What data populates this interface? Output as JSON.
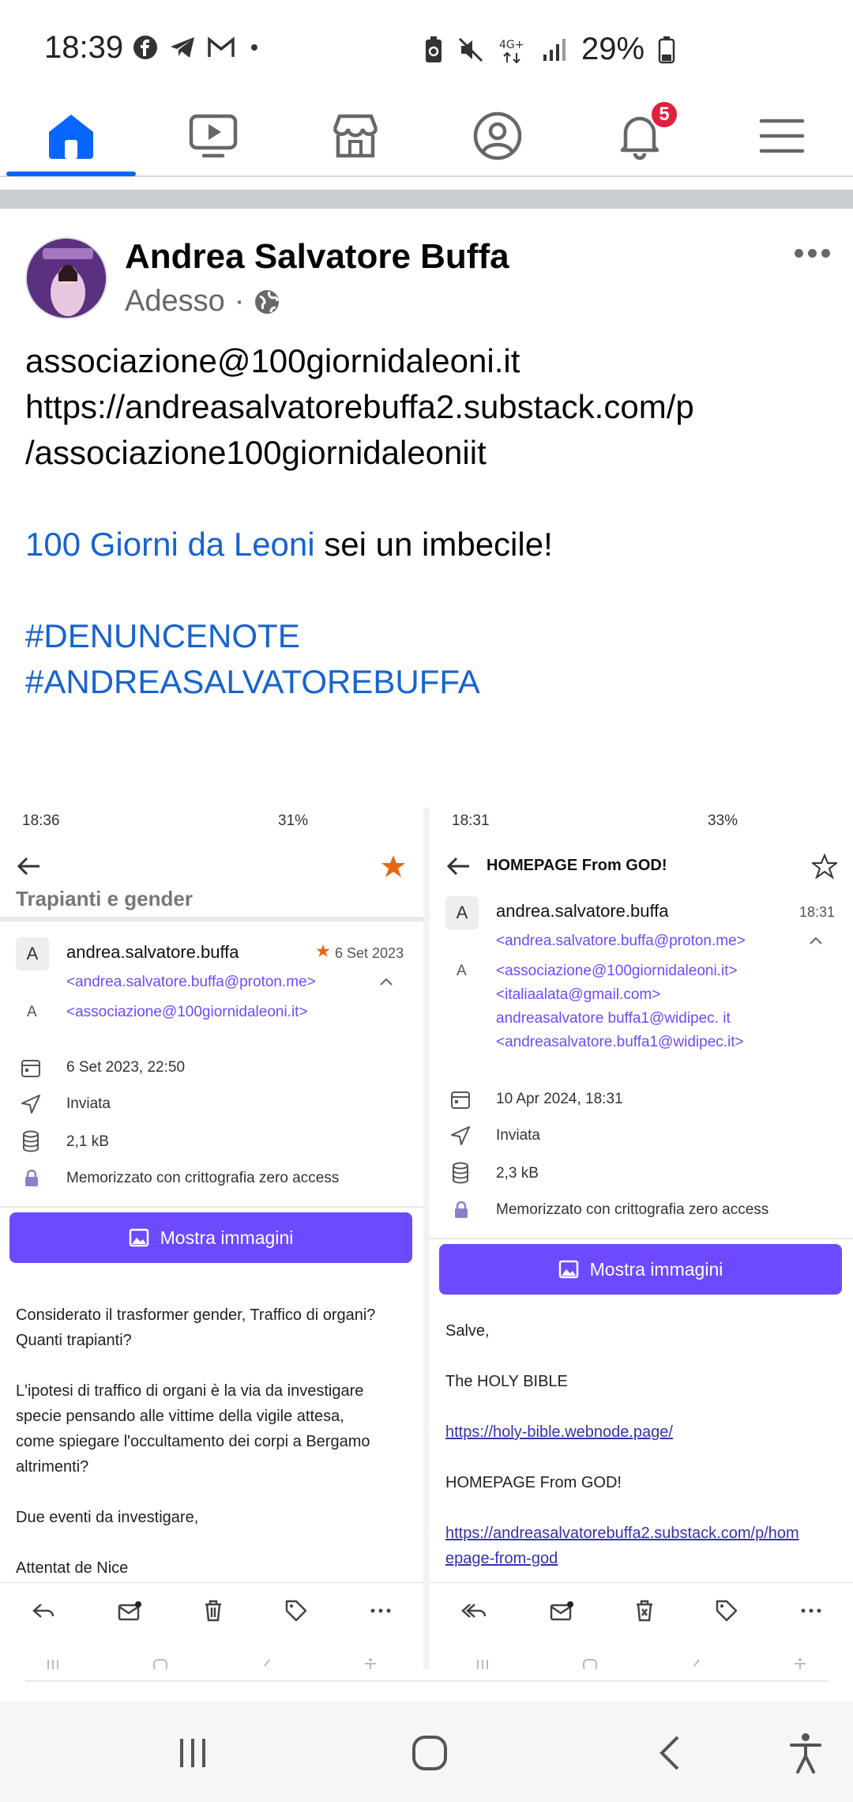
{
  "status_bar": {
    "time": "18:39",
    "battery": "29%",
    "left_icons": [
      "facebook-icon",
      "telegram-icon",
      "gmail-icon",
      "dot-icon"
    ],
    "right_icons": [
      "battery-saver-icon",
      "mute-icon",
      "network-4g-icon",
      "signal-icon"
    ]
  },
  "fb_nav": {
    "items": [
      "home",
      "video",
      "marketplace",
      "profile",
      "notifications",
      "menu"
    ],
    "notifications_badge": "5",
    "accent": "#0866ff"
  },
  "post": {
    "author": "Andrea Salvatore Buffa",
    "time": "Adesso",
    "separator": "·",
    "body_lines": [
      {
        "text": "associazione@100giornidaleoni.it"
      },
      {
        "text": "https://andreasalvatorebuffa2.substack.com/p"
      },
      {
        "text": "/associazione100giornidaleoniit"
      },
      {
        "text": ""
      },
      {
        "link": "100 Giorni da Leoni",
        "text": " sei un imbecile!"
      },
      {
        "text": ""
      },
      {
        "link": "#DENUNCENOTE"
      },
      {
        "link": "#ANDREASALVATOREBUFFA"
      },
      {
        "text": ""
      },
      {
        "text": ""
      },
      {
        "text": "."
      }
    ]
  },
  "left_email": {
    "status_time": "18:36",
    "status_battery": "31%",
    "subject": "Trapianti e gender",
    "sender_initial": "A",
    "sender": "andrea.salvatore.buffa",
    "date_short": "6 Set 2023",
    "sender_email": "<andrea.salvatore.buffa@proton.me>",
    "to_initial": "A",
    "to_email": "<associazione@100giornidaleoni.it>",
    "date_full": "6 Set 2023, 22:50",
    "folder": "Inviata",
    "size": "2,1 kB",
    "encryption": "Memorizzato con crittografia zero access",
    "show_images": "Mostra immagini",
    "body_lines": [
      "Considerato il trasformer gender, Traffico di organi?",
      "Quanti trapianti?",
      "",
      "L'ipotesi di traffico di organi è la via da investigare",
      "specie pensando alle vittime della vigile attesa,",
      "come spiegare l'occultamento dei corpi a Bergamo",
      "altrimenti?",
      "",
      "Due eventi da investigare,",
      "",
      "Attentat de Nice"
    ]
  },
  "right_email": {
    "status_time": "18:31",
    "status_battery": "33%",
    "subject": "HOMEPAGE From GOD!",
    "sender_initial": "A",
    "sender": "andrea.salvatore.buffa",
    "time": "18:31",
    "sender_email": "<andrea.salvatore.buffa@proton.me>",
    "to_initial": "A",
    "to_lines": [
      "<associazione@100giornidaleoni.it>",
      "<italiaalata@gmail.com>",
      "andreasalvatore buffa1@widipec. it",
      "<andreasalvatore.buffa1@widipec.it>"
    ],
    "date_full": "10 Apr 2024, 18:31",
    "folder": "Inviata",
    "size": "2,3 kB",
    "encryption": "Memorizzato con crittografia zero access",
    "show_images": "Mostra immagini",
    "body": {
      "greeting": "Salve,",
      "line1": "The HOLY BIBLE",
      "link1": "https://holy-bible.webnode.page/",
      "line2": "HOMEPAGE From GOD!",
      "link2a": "https://andreasalvatorebuffa2.substack.com/p/hom",
      "link2b": "epage-from-god"
    }
  },
  "system_nav": [
    "recents",
    "home",
    "back",
    "accessibility"
  ]
}
